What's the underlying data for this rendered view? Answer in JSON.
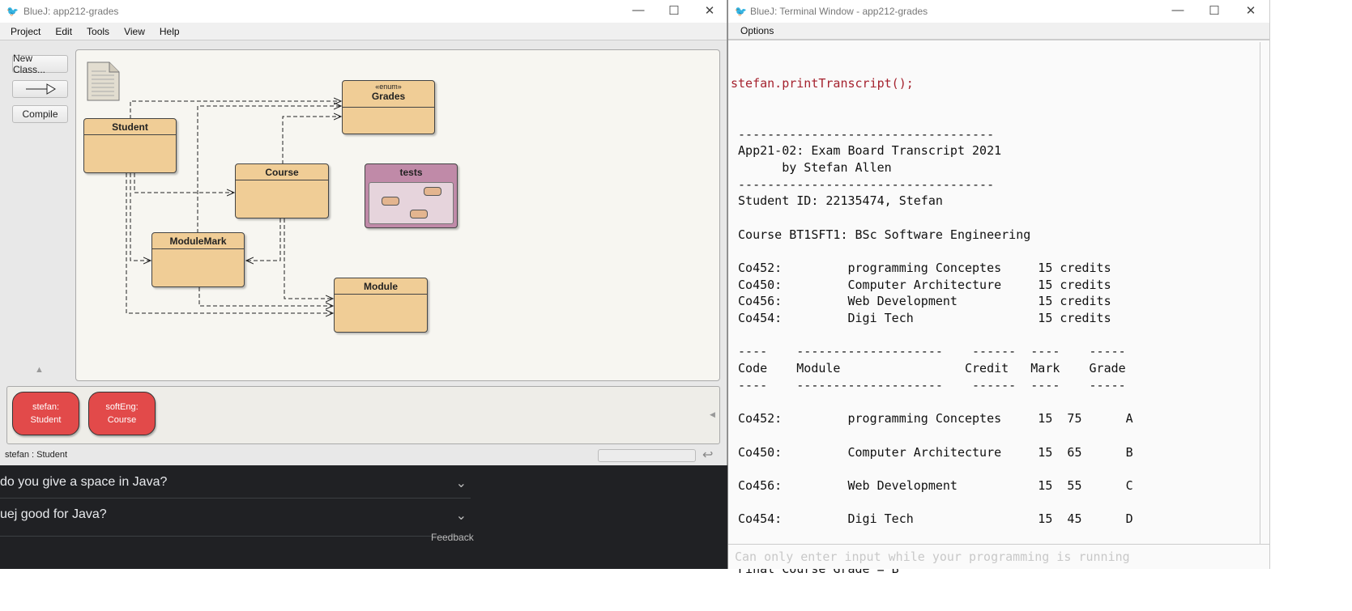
{
  "main_window": {
    "title": "BlueJ:  app212-grades",
    "menu": [
      "Project",
      "Edit",
      "Tools",
      "View",
      "Help"
    ],
    "toolbar": {
      "new_class": "New Class...",
      "compile": "Compile"
    },
    "classes": {
      "grades": {
        "stereotype": "«enum»",
        "name": "Grades"
      },
      "student": {
        "name": "Student"
      },
      "course": {
        "name": "Course"
      },
      "tests": {
        "name": "tests"
      },
      "modulemark": {
        "name": "ModuleMark"
      },
      "module": {
        "name": "Module"
      }
    },
    "objects": [
      {
        "name": "stefan:",
        "type": "Student"
      },
      {
        "name": "softEng:",
        "type": "Course"
      }
    ],
    "status": "stefan : Student"
  },
  "background_page": {
    "questions": [
      "do you give a space in Java?",
      "uej good for Java?"
    ],
    "feedback": "Feedback"
  },
  "terminal": {
    "title": "BlueJ: Terminal Window - app212-grades",
    "menu": [
      "Options"
    ],
    "command": "stefan.printTranscript();",
    "lines": [
      " -----------------------------------",
      " App21-02: Exam Board Transcript 2021",
      "       by Stefan Allen",
      " -----------------------------------",
      " Student ID: 22135474, Stefan",
      "",
      " Course BT1SFT1: BSc Software Engineering",
      "",
      " Co452:         programming Conceptes     15 credits",
      " Co450:         Computer Architecture     15 credits",
      " Co456:         Web Development           15 credits",
      " Co454:         Digi Tech                 15 credits",
      "",
      " ----    --------------------    ------  ----    -----",
      " Code    Module                 Credit   Mark    Grade",
      " ----    --------------------    ------  ----    -----",
      "",
      " Co452:         programming Conceptes     15  75      A",
      "",
      " Co450:         Computer Architecture     15  65      B",
      "",
      " Co456:         Web Development           15  55      C",
      "",
      " Co454:         Digi Tech                 15  45      D",
      "",
      "",
      " Final Course Grade = B"
    ],
    "input_placeholder": "Can only enter input while your programming is running"
  },
  "colors": {
    "class_fill": "#f0cd96",
    "test_fill": "#c08aa8",
    "object_fill": "#e24a4a",
    "command_text": "#a5222e"
  }
}
